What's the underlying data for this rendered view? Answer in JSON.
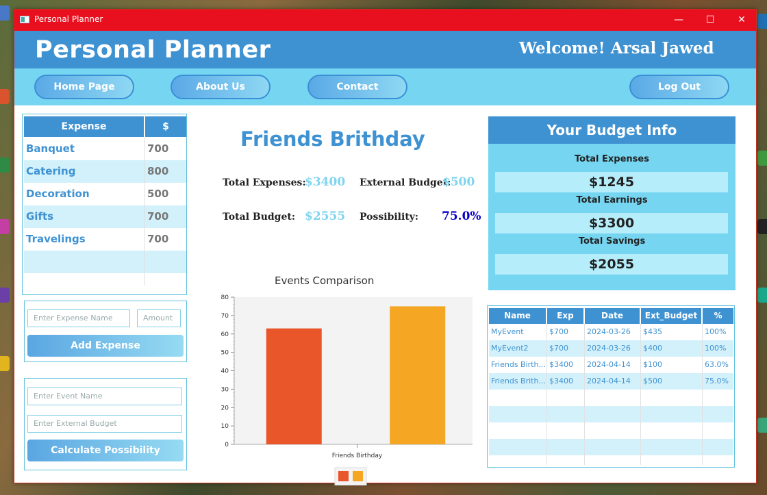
{
  "window": {
    "title": "Personal Planner",
    "controls": {
      "minimize": "—",
      "maximize": "☐",
      "close": "✕"
    }
  },
  "header": {
    "brand": "Personal Planner",
    "welcome": "Welcome! Arsal Jawed"
  },
  "nav": {
    "home": "Home Page",
    "about": "About Us",
    "contact": "Contact",
    "logout": "Log Out"
  },
  "expenses": {
    "headers": [
      "Expense",
      "$"
    ],
    "rows": [
      {
        "name": "Banquet",
        "amount": "700"
      },
      {
        "name": "Catering",
        "amount": "800"
      },
      {
        "name": "Decoration",
        "amount": "500"
      },
      {
        "name": "Gifts",
        "amount": "700"
      },
      {
        "name": "Travelings",
        "amount": "700"
      }
    ]
  },
  "expense_form": {
    "name_placeholder": "Enter Expense Name",
    "amount_placeholder": "Amount",
    "add_label": "Add Expense"
  },
  "event_form": {
    "event_placeholder": "Enter Event Name",
    "budget_placeholder": "Enter External Budget",
    "calc_label": "Calculate Possibility"
  },
  "event": {
    "title": "Friends Brithday",
    "total_expenses_label": "Total Expenses:",
    "total_expenses_value": "$3400",
    "external_budget_label": "External Budget:",
    "external_budget_value": "$500",
    "total_budget_label": "Total Budget:",
    "total_budget_value": "$2555",
    "possibility_label": "Possibility:",
    "possibility_value": "75.0%"
  },
  "chart_data": {
    "type": "bar",
    "title": "Events Comparison",
    "categories": [
      "Friends Birthday"
    ],
    "series": [
      {
        "values": [
          63
        ],
        "color": "#e8562a"
      },
      {
        "values": [
          75
        ],
        "color": "#f5a623"
      }
    ],
    "ylim": [
      0,
      80
    ],
    "y_ticks": [
      "0",
      "10",
      "20",
      "30",
      "40",
      "50",
      "60",
      "70",
      "80"
    ],
    "grid": false,
    "legend": "bottom"
  },
  "budget_info": {
    "title": "Your Budget Info",
    "expenses_label": "Total Expenses",
    "expenses_value": "$1245",
    "earnings_label": "Total Earnings",
    "earnings_value": "$3300",
    "savings_label": "Total Savings",
    "savings_value": "$2055"
  },
  "events_table": {
    "headers": [
      "Name",
      "Exp",
      "Date",
      "Ext_Budget",
      "%"
    ],
    "rows": [
      [
        "MyEvent",
        "$700",
        "2024-03-26",
        "$435",
        "100%"
      ],
      [
        "MyEvent2",
        "$700",
        "2024-03-26",
        "$400",
        "100%"
      ],
      [
        "Friends Birth...",
        "$3400",
        "2024-04-14",
        "$100",
        "63.0%"
      ],
      [
        "Friends Brith...",
        "$3400",
        "2024-04-14",
        "$500",
        "75.0%"
      ]
    ]
  },
  "colors": {
    "primary": "#3f92d2",
    "light": "#76d6f2",
    "accent_dark": "#0a00cc",
    "titlebar": "#e8101f"
  }
}
